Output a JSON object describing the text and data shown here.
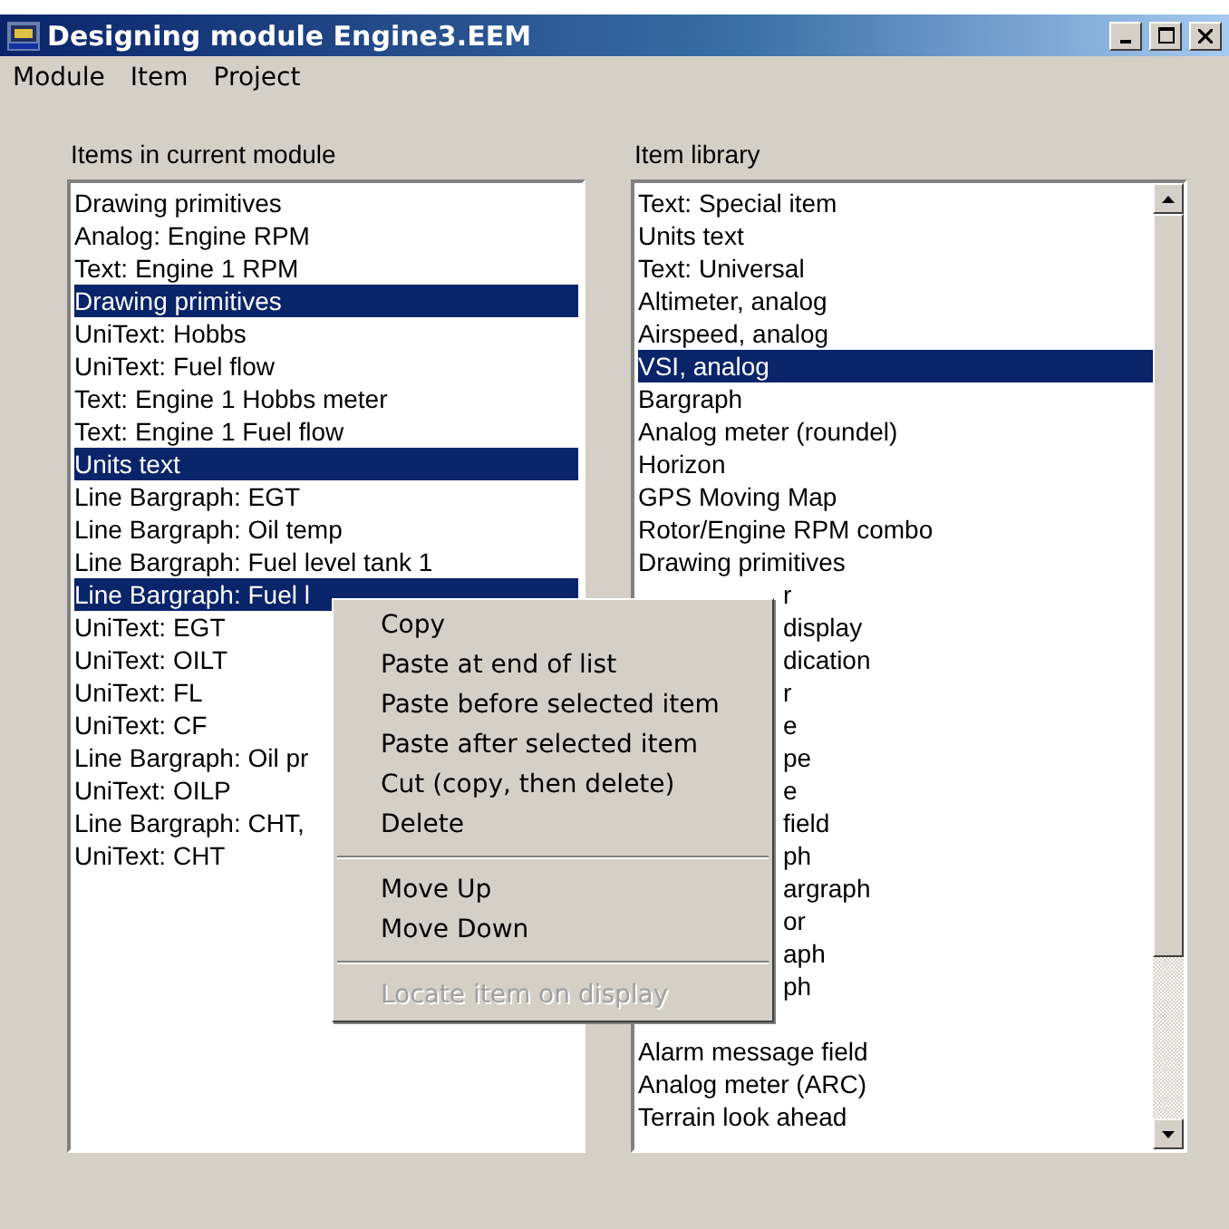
{
  "window": {
    "title": "Designing module Engine3.EEM"
  },
  "menu_bar": [
    "Module",
    "Item",
    "Project"
  ],
  "module_items": {
    "label": "Items in current module",
    "items": [
      {
        "text": "Drawing primitives",
        "selected": false
      },
      {
        "text": "Analog: Engine RPM",
        "selected": false
      },
      {
        "text": "Text: Engine 1 RPM",
        "selected": false
      },
      {
        "text": "Drawing primitives",
        "selected": true
      },
      {
        "text": "UniText: Hobbs",
        "selected": false
      },
      {
        "text": "UniText: Fuel flow",
        "selected": false
      },
      {
        "text": "Text: Engine 1 Hobbs meter",
        "selected": false
      },
      {
        "text": "Text: Engine 1 Fuel flow",
        "selected": false
      },
      {
        "text": "Units text",
        "selected": true
      },
      {
        "text": "Line Bargraph: EGT",
        "selected": false
      },
      {
        "text": "Line Bargraph: Oil temp",
        "selected": false
      },
      {
        "text": "Line Bargraph: Fuel level tank 1",
        "selected": false
      },
      {
        "text": "Line Bargraph: Fuel l",
        "selected": true
      },
      {
        "text": "UniText: EGT",
        "selected": false
      },
      {
        "text": "UniText: OILT",
        "selected": false
      },
      {
        "text": "UniText: FL",
        "selected": false
      },
      {
        "text": "UniText: CF",
        "selected": false
      },
      {
        "text": "Line Bargraph: Oil pr",
        "selected": false
      },
      {
        "text": "UniText: OILP",
        "selected": false
      },
      {
        "text": "Line Bargraph: CHT,",
        "selected": false
      },
      {
        "text": "UniText: CHT",
        "selected": false
      }
    ]
  },
  "item_library": {
    "label": "Item library",
    "items": [
      {
        "kind": "full",
        "text": "Text: Special item",
        "selected": false
      },
      {
        "kind": "full",
        "text": "Units text",
        "selected": false
      },
      {
        "kind": "full",
        "text": "Text: Universal",
        "selected": false
      },
      {
        "kind": "full",
        "text": "Altimeter, analog",
        "selected": false
      },
      {
        "kind": "full",
        "text": "Airspeed, analog",
        "selected": false
      },
      {
        "kind": "full",
        "text": "VSI, analog",
        "selected": true
      },
      {
        "kind": "full",
        "text": "Bargraph",
        "selected": false
      },
      {
        "kind": "full",
        "text": "Analog meter (roundel)",
        "selected": false
      },
      {
        "kind": "full",
        "text": "Horizon",
        "selected": false
      },
      {
        "kind": "full",
        "text": "GPS Moving Map",
        "selected": false
      },
      {
        "kind": "full",
        "text": "Rotor/Engine RPM combo",
        "selected": false
      },
      {
        "kind": "full",
        "text": "Drawing primitives",
        "selected": false
      },
      {
        "kind": "cut",
        "text": "r",
        "selected": false
      },
      {
        "kind": "cut",
        "text": "display",
        "selected": false
      },
      {
        "kind": "cut",
        "text": "dication",
        "selected": false
      },
      {
        "kind": "cut",
        "text": "r",
        "selected": false
      },
      {
        "kind": "cut",
        "text": "e",
        "selected": false
      },
      {
        "kind": "cut",
        "text": "pe",
        "selected": false
      },
      {
        "kind": "cut",
        "text": "e",
        "selected": false
      },
      {
        "kind": "cut",
        "text": "field",
        "selected": false
      },
      {
        "kind": "cut",
        "text": "ph",
        "selected": false
      },
      {
        "kind": "cut",
        "text": "argraph",
        "selected": false
      },
      {
        "kind": "cut",
        "text": "or",
        "selected": false
      },
      {
        "kind": "cut",
        "text": "aph",
        "selected": false
      },
      {
        "kind": "cut",
        "text": "ph",
        "selected": false
      },
      {
        "kind": "hidden",
        "selected": false
      },
      {
        "kind": "full",
        "text": "Alarm message field",
        "selected": false
      },
      {
        "kind": "full",
        "text": "Analog meter (ARC)",
        "selected": false
      },
      {
        "kind": "full",
        "text": "Terrain look ahead",
        "selected": false
      }
    ]
  },
  "context_menu": [
    {
      "kind": "item",
      "text": "Copy",
      "disabled": false
    },
    {
      "kind": "item",
      "text": "Paste at end of list",
      "disabled": false
    },
    {
      "kind": "item",
      "text": "Paste before selected item",
      "disabled": false
    },
    {
      "kind": "item",
      "text": "Paste after selected item",
      "disabled": false
    },
    {
      "kind": "item",
      "text": "Cut (copy, then delete)",
      "disabled": false
    },
    {
      "kind": "item",
      "text": "Delete",
      "disabled": false
    },
    {
      "kind": "separator"
    },
    {
      "kind": "item",
      "text": "Move Up",
      "disabled": false
    },
    {
      "kind": "item",
      "text": "Move Down",
      "disabled": false
    },
    {
      "kind": "separator"
    },
    {
      "kind": "item",
      "text": "Locate item on display",
      "disabled": true
    }
  ]
}
